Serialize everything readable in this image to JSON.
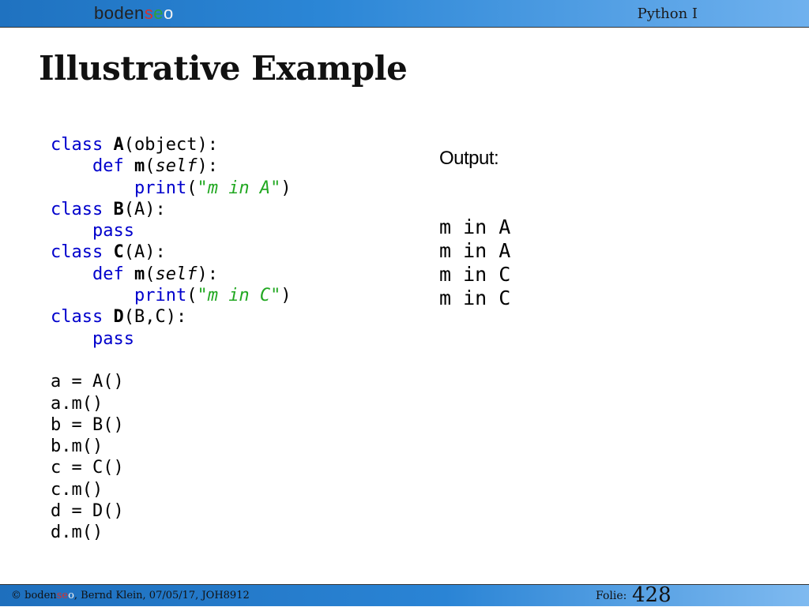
{
  "header": {
    "logo": {
      "part1": "boden",
      "part2": "s",
      "part3": "e",
      "part4": "o"
    },
    "course": "Python I"
  },
  "title": "Illustrative Example",
  "code": {
    "l1": {
      "kw": "class",
      "name": "A",
      "rest": "(object):"
    },
    "l2": {
      "kw": "def",
      "name": "m",
      "self": "self",
      "rest": "):"
    },
    "l3": {
      "kw": "print",
      "str": "\"m in A\"",
      "rest": ")"
    },
    "l4": {
      "kw": "class",
      "name": "B",
      "rest": "(A):"
    },
    "l5": {
      "kw": "pass"
    },
    "l6": {
      "kw": "class",
      "name": "C",
      "rest": "(A):"
    },
    "l7": {
      "kw": "def",
      "name": "m",
      "self": "self",
      "rest": "):"
    },
    "l8": {
      "kw": "print",
      "str": "\"m in C\"",
      "rest": ")"
    },
    "l9": {
      "kw": "class",
      "name": "D",
      "rest": "(B,C):"
    },
    "l10": {
      "kw": "pass"
    },
    "statements": [
      "a = A()",
      "a.m()",
      "b = B()",
      "b.m()",
      "c = C()",
      "c.m()",
      "d = D()",
      "d.m()"
    ]
  },
  "output": {
    "label": "Output:",
    "lines": [
      "m in A",
      "m in A",
      "m in C",
      "m in C"
    ]
  },
  "footer": {
    "copyright": "© ",
    "logo": {
      "part1": "boden",
      "part2": "se",
      "part3": "o"
    },
    "info": ", Bernd Klein, 07/05/17, JOH8912",
    "folie_label": "Folie:",
    "slide_number": "428"
  }
}
